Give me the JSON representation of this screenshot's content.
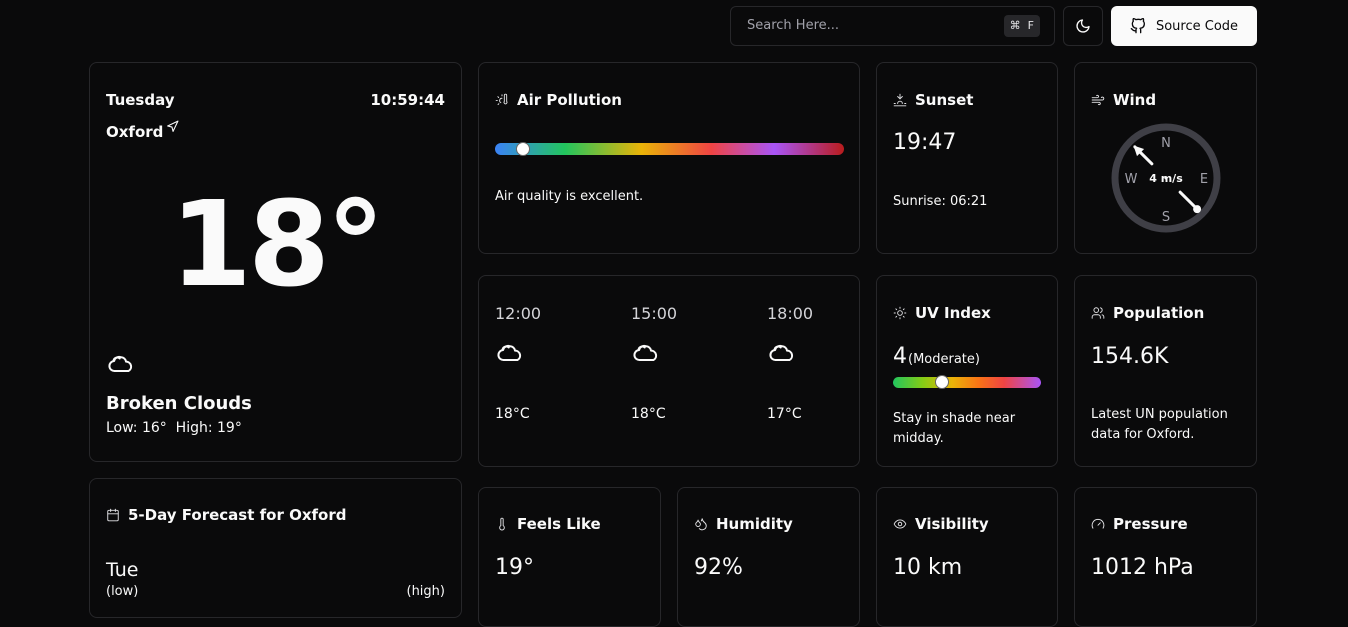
{
  "topbar": {
    "search_placeholder": "Search Here...",
    "shortcut_cmd": "⌘",
    "shortcut_key": "F",
    "source_label": "Source Code"
  },
  "current": {
    "day": "Tuesday",
    "time": "10:59:44",
    "city": "Oxford",
    "temp": "18°",
    "condition": "Broken Clouds",
    "low_high": "Low: 16°  High: 19°"
  },
  "forecast": {
    "title": "5-Day Forecast for Oxford",
    "first_day": "Tue",
    "low_label": "(low)",
    "high_label": "(high)"
  },
  "air": {
    "title": "Air Pollution",
    "level": 0.08,
    "text": "Air quality is excellent."
  },
  "sunset": {
    "title": "Sunset",
    "time": "19:47",
    "sunrise": "Sunrise: 06:21"
  },
  "wind": {
    "title": "Wind",
    "speed": "4 m/s",
    "n": "N",
    "e": "E",
    "s": "S",
    "w": "W",
    "direction_deg": 135
  },
  "hourly": [
    {
      "time": "12:00",
      "temp": "18°C",
      "icon": "cloud-icon"
    },
    {
      "time": "15:00",
      "temp": "18°C",
      "icon": "cloud-icon"
    },
    {
      "time": "18:00",
      "temp": "17°C",
      "icon": "cloud-icon"
    }
  ],
  "uv": {
    "title": "UV Index",
    "value": "4",
    "category": "(Moderate)",
    "level": 0.33,
    "text": "Stay in shade near midday."
  },
  "population": {
    "title": "Population",
    "value": "154.6K",
    "text": "Latest UN population data for Oxford."
  },
  "feels": {
    "title": "Feels Like",
    "value": "19°"
  },
  "humidity": {
    "title": "Humidity",
    "value": "92%"
  },
  "visibility": {
    "title": "Visibility",
    "value": "10 km"
  },
  "pressure": {
    "title": "Pressure",
    "value": "1012 hPa"
  }
}
